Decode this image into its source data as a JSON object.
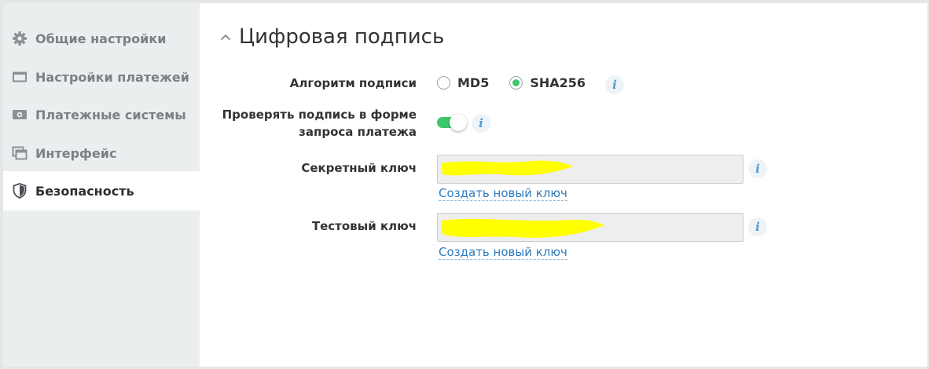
{
  "sidebar": {
    "items": [
      {
        "label": "Общие настройки",
        "icon": "gear-icon",
        "active": false
      },
      {
        "label": "Настройки платежей",
        "icon": "card-icon",
        "active": false
      },
      {
        "label": "Платежные системы",
        "icon": "cash-icon",
        "active": false
      },
      {
        "label": "Интерфейс",
        "icon": "window-icon",
        "active": false
      },
      {
        "label": "Безопасность",
        "icon": "shield-icon",
        "active": true
      }
    ]
  },
  "section": {
    "title": "Цифровая подпись",
    "collapse_icon": "chevron-up-icon"
  },
  "form": {
    "algorithm": {
      "label": "Алгоритм подписи",
      "options": [
        "MD5",
        "SHA256"
      ],
      "selected": "SHA256"
    },
    "verify_signature": {
      "label_line1": "Проверять подпись в форме",
      "label_line2": "запроса платежа",
      "enabled": true
    },
    "secret_key": {
      "label": "Секретный ключ",
      "value": "",
      "action_link": "Создать новый ключ"
    },
    "test_key": {
      "label": "Тестовый ключ",
      "value": "",
      "action_link": "Создать новый ключ"
    },
    "info_icon": "i"
  },
  "colors": {
    "accent_green": "#3bc86b",
    "link_blue": "#2f7bbd",
    "redaction_yellow": "#ffff00",
    "sidebar_bg": "#ebeeef"
  }
}
